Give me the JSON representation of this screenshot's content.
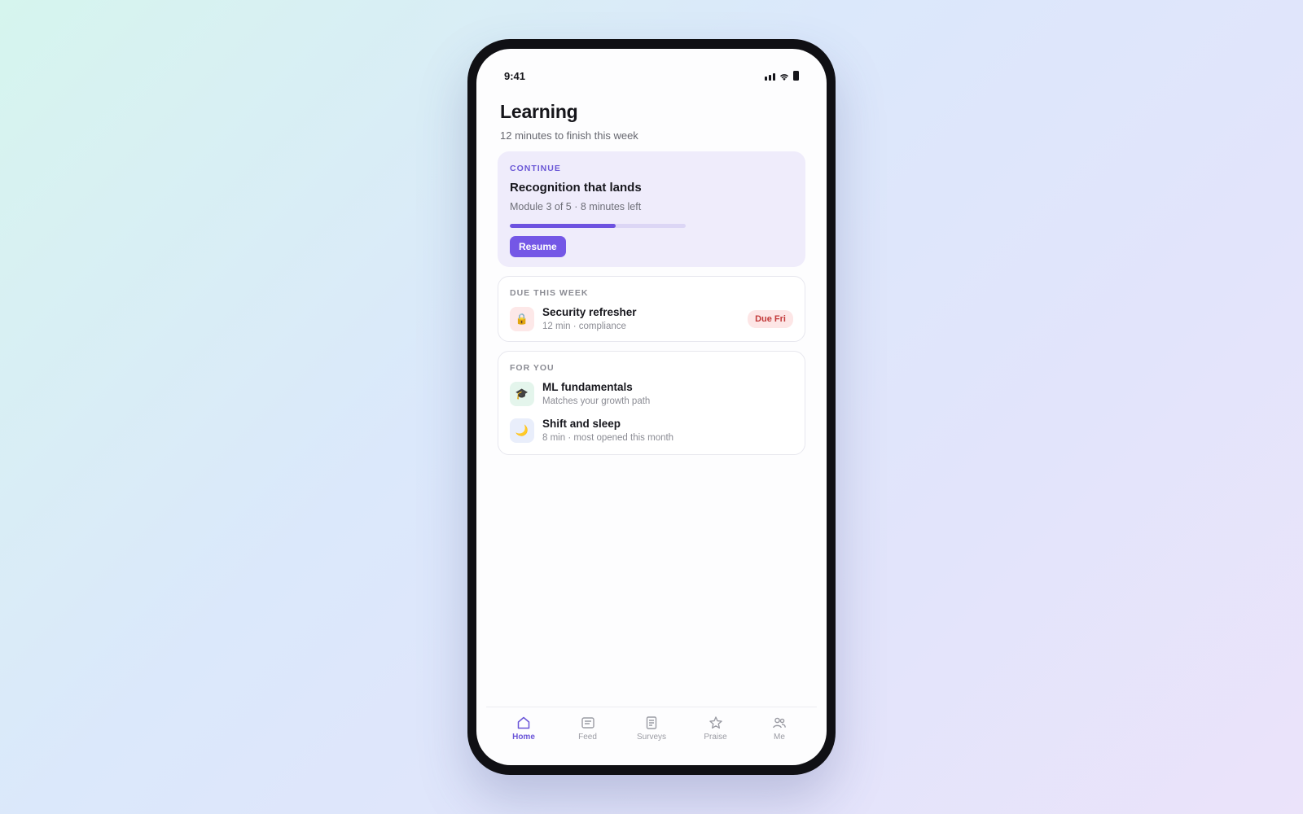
{
  "status_bar": {
    "time": "9:41"
  },
  "page": {
    "title": "Learning",
    "subtitle": "12 minutes to finish this week"
  },
  "continue_card": {
    "eyebrow": "CONTINUE",
    "title": "Recognition that lands",
    "meta": "Module 3 of 5 · 8 minutes left",
    "progress_fraction": 0.6,
    "button_label": "Resume"
  },
  "due_card": {
    "label": "DUE THIS WEEK",
    "items": [
      {
        "icon": "lock-icon",
        "glyph": "🔒",
        "icon_bg": "#fde8e8",
        "title": "Security refresher",
        "sub": "12 min · compliance",
        "badge": "Due Fri"
      }
    ]
  },
  "for_you_card": {
    "label": "FOR YOU",
    "items": [
      {
        "icon": "graduation-cap-icon",
        "glyph": "🎓",
        "icon_bg": "#e4f5ec",
        "title": "ML fundamentals",
        "sub": "Matches your growth path"
      },
      {
        "icon": "moon-icon",
        "glyph": "🌙",
        "icon_bg": "#e9eefb",
        "title": "Shift and sleep",
        "sub": "8 min · most opened this month"
      }
    ]
  },
  "tab_bar": {
    "tabs": [
      {
        "label": "Home",
        "icon": "home-icon",
        "active": true
      },
      {
        "label": "Feed",
        "icon": "feed-icon",
        "active": false
      },
      {
        "label": "Surveys",
        "icon": "survey-icon",
        "active": false
      },
      {
        "label": "Praise",
        "icon": "star-icon",
        "active": false
      },
      {
        "label": "Me",
        "icon": "people-icon",
        "active": false
      }
    ]
  },
  "colors": {
    "accent": "#7457e6",
    "due_badge": "#c23a3a",
    "card_tint": "#efecfb"
  }
}
